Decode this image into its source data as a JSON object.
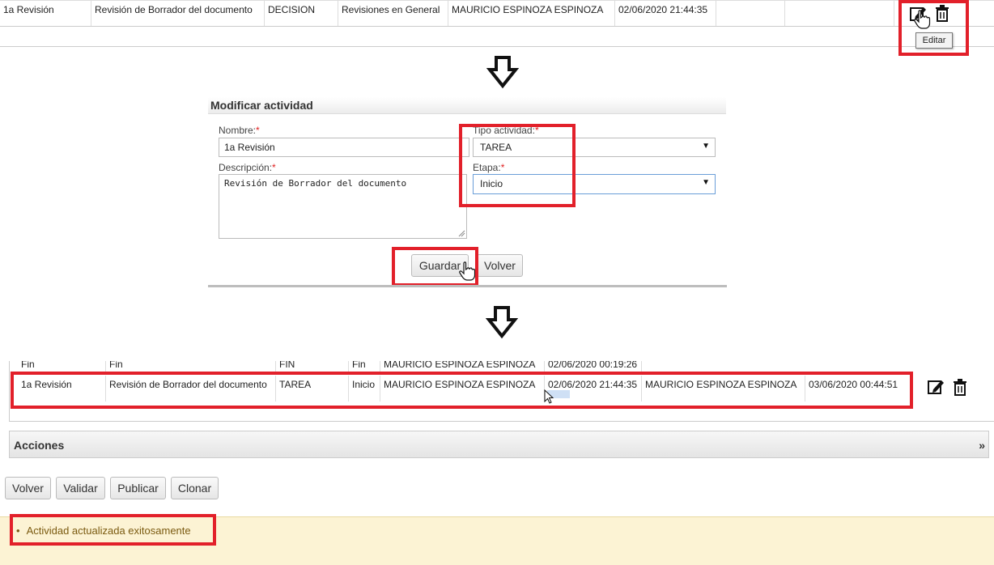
{
  "top_table": {
    "row": {
      "nombre": "1a Revisión",
      "descripcion": "Revisión de Borrador del documento",
      "tipo": "DECISION",
      "etapa": "Revisiones en General",
      "responsable": "MAURICIO ESPINOZA ESPINOZA",
      "fecha": "02/06/2020 21:44:35"
    },
    "tooltip": "Editar"
  },
  "form": {
    "title": "Modificar actividad",
    "nombre_label": "Nombre:",
    "nombre_value": "1a Revisión",
    "descripcion_label": "Descripción:",
    "descripcion_value": "Revisión de Borrador del documento",
    "tipo_label": "Tipo actividad:",
    "tipo_value": "TAREA",
    "etapa_label": "Etapa:",
    "etapa_value": "Inicio",
    "required_mark": "*",
    "guardar_label": "Guardar",
    "volver_label": "Volver"
  },
  "bottom_table": {
    "partial_row": {
      "c1": "Fin",
      "c2": "Fin",
      "c3": "FIN",
      "c4": "Fin",
      "c5": "MAURICIO ESPINOZA ESPINOZA",
      "c6": "02/06/2020 00:19:26"
    },
    "row": {
      "nombre": "1a Revisión",
      "descripcion": "Revisión de Borrador del documento",
      "tipo": "TAREA",
      "etapa": "Inicio",
      "creador": "MAURICIO ESPINOZA ESPINOZA",
      "fecha_creacion": "02/06/2020 21:44:35",
      "modificador": "MAURICIO ESPINOZA ESPINOZA",
      "fecha_modificacion": "03/06/2020 00:44:51"
    }
  },
  "acciones": {
    "title": "Acciones",
    "expand_glyph": "»"
  },
  "bottom_buttons": {
    "volver": "Volver",
    "validar": "Validar",
    "publicar": "Publicar",
    "clonar": "Clonar"
  },
  "message": {
    "bullet": "•",
    "text": "Actividad actualizada exitosamente"
  },
  "colors": {
    "highlight_red": "#e2202a",
    "message_bg": "#fcf3d4",
    "message_text": "#7a5a10"
  }
}
